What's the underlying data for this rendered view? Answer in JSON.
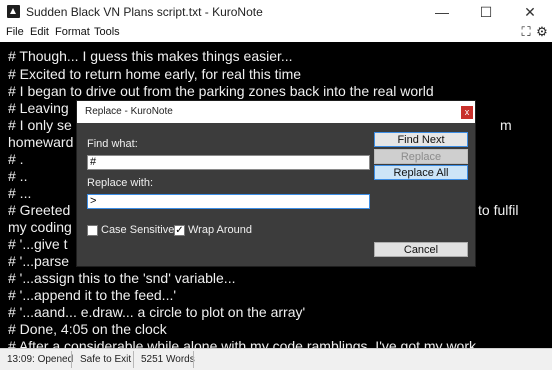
{
  "window": {
    "title": "Sudden Black VN Plans script.txt - KuroNote",
    "minimize_glyph": "—",
    "maximize_glyph": "☐",
    "close_glyph": "✕"
  },
  "menu": {
    "items": [
      "File",
      "Edit",
      "Format",
      "Tools"
    ],
    "fullscreen_icon": "fullscreen-icon",
    "fullscreen_glyph": "⛶",
    "settings_icon": "gear-icon",
    "settings_glyph": "⚙"
  },
  "editor": {
    "lines": [
      "# Though... I guess this makes things easier...",
      "# Excited to return home early, for real this time",
      "# I began to drive out from the parking zones back into the real world",
      "# Leaving",
      "# I only se",
      "homeward",
      "# .",
      "# ..",
      "# ...",
      "# Greeted",
      "my coding",
      "# '...give t",
      "# '...parse",
      "# '...assign this to the 'snd' variable...",
      "# '...append it to the feed...'",
      "# '...aand... e.draw... a circle to plot on the array'",
      "# Done, 4:05 on the clock",
      "# After a considerable while alone with my code ramblings, I've got my work"
    ],
    "fragments": {
      "line3_tail": "m",
      "line9_tail": "to fulfil"
    }
  },
  "status": {
    "time_status": "13:09: Opened",
    "save_status": "Safe to Exit",
    "word_count": "5251 Words"
  },
  "dialog": {
    "title": "Replace - KuroNote",
    "close_glyph": "x",
    "find_label": "Find what:",
    "find_value": "#",
    "replace_label": "Replace with:",
    "replace_value": ">",
    "case_sensitive_label": "Case Sensitive",
    "case_sensitive_checked": false,
    "wrap_around_label": "Wrap Around",
    "wrap_around_checked": true,
    "check_glyph": "✓",
    "find_next_label": "Find Next",
    "replace_label_btn": "Replace",
    "replace_all_label": "Replace All",
    "cancel_label": "Cancel"
  }
}
